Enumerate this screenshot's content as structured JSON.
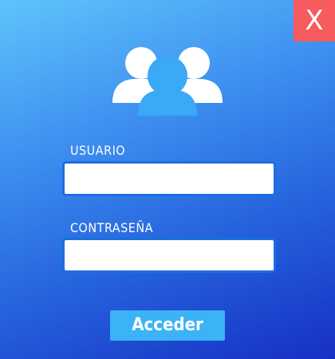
{
  "window": {
    "close_label": "X"
  },
  "header": {
    "icon": "users-group-icon"
  },
  "form": {
    "username": {
      "label": "USUARIO",
      "value": "",
      "placeholder": ""
    },
    "password": {
      "label": "CONTRASEÑA",
      "value": "",
      "placeholder": ""
    },
    "submit_label": "Acceder"
  },
  "colors": {
    "background_top": "#5ec4fb",
    "background_bottom": "#1730c4",
    "close_button": "#f65b5e",
    "icon_back": "#ffffff",
    "icon_front": "#3ba9f5",
    "field_border": "#1b6fe0",
    "submit_button": "#3bb3f6"
  }
}
